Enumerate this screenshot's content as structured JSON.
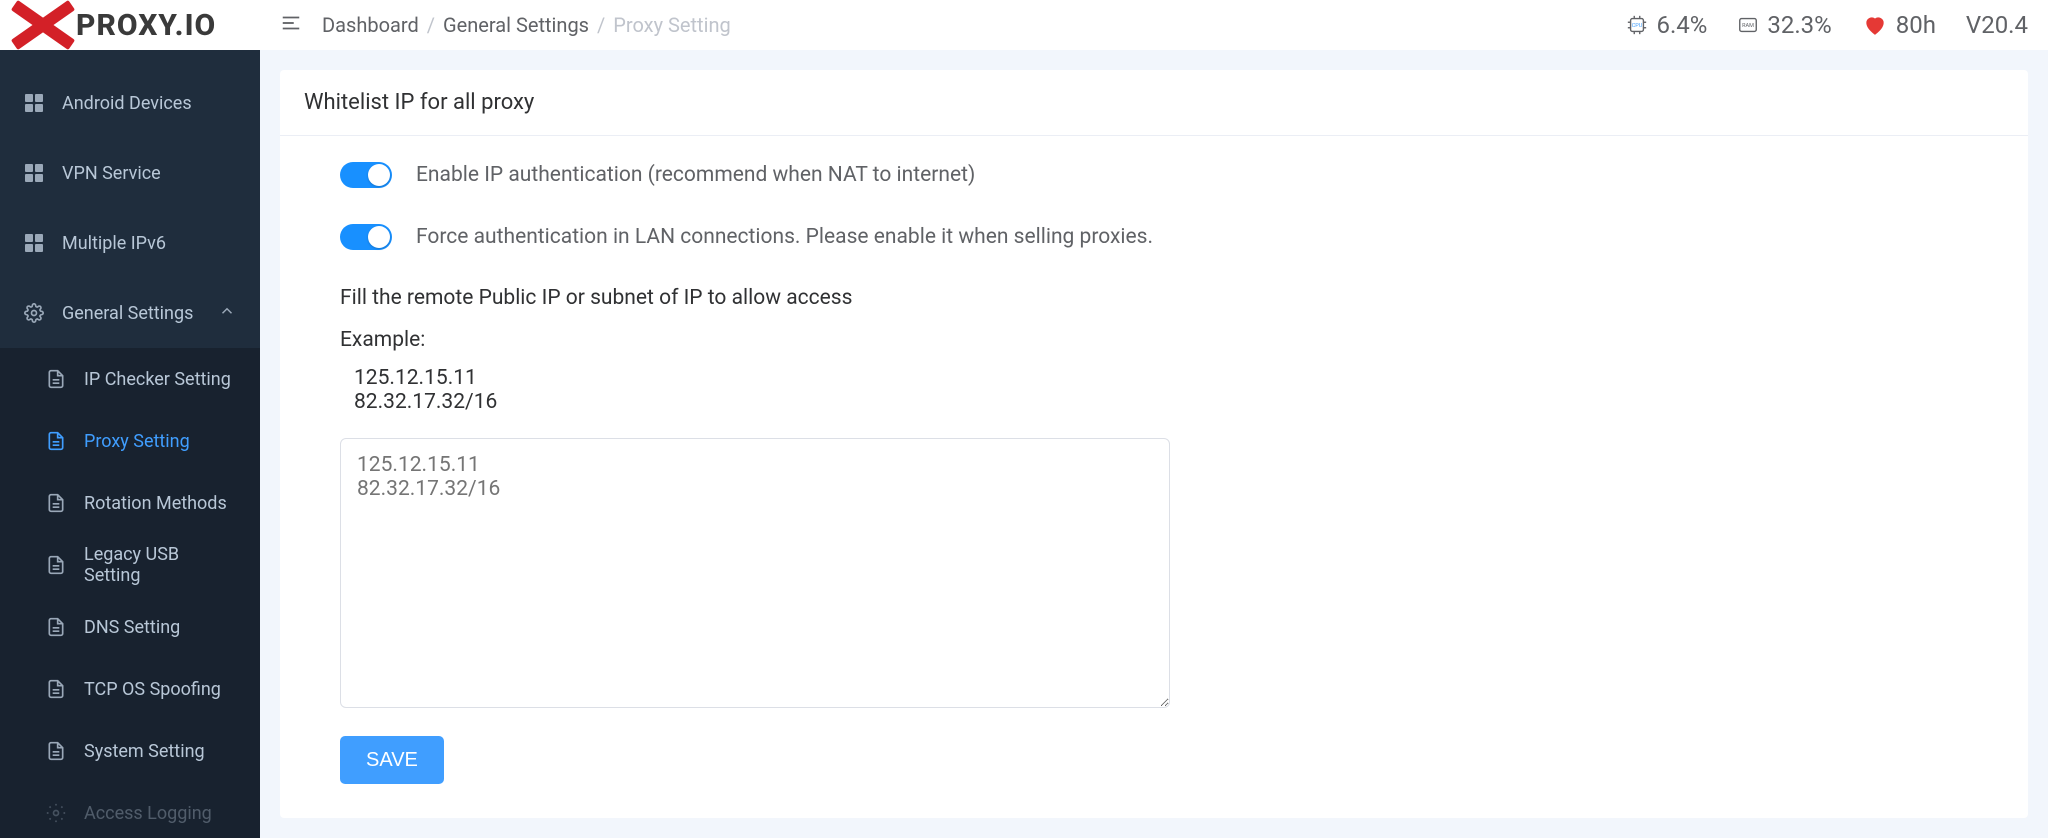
{
  "brand": {
    "name": "PROXY.IO"
  },
  "breadcrumb": {
    "dashboard": "Dashboard",
    "general": "General Settings",
    "current": "Proxy Setting"
  },
  "status": {
    "cpu_label": "CPU",
    "cpu": "6.4%",
    "ram_label": "RAM",
    "ram": "32.3%",
    "uptime": "80h",
    "version": "V20.4"
  },
  "sidebar": {
    "android": "Android Devices",
    "vpn": "VPN Service",
    "ipv6": "Multiple IPv6",
    "general": "General Settings",
    "sub": {
      "ipchecker": "IP Checker Setting",
      "proxy": "Proxy Setting",
      "rotation": "Rotation Methods",
      "legacyusb": "Legacy USB Setting",
      "dns": "DNS Setting",
      "tcpos": "TCP OS Spoofing",
      "system": "System Setting",
      "access": "Access Logging"
    }
  },
  "card": {
    "title": "Whitelist IP for all proxy",
    "switch1": "Enable IP authentication (recommend when NAT to internet)",
    "switch2": "Force authentication in LAN connections. Please enable it when selling proxies.",
    "subtitle": "Fill the remote Public IP or subnet of IP to allow access",
    "example_label": "Example:",
    "example_block": "125.12.15.11\n82.32.17.32/16",
    "placeholder": "125.12.15.11\n82.32.17.32/16",
    "save": "SAVE"
  }
}
